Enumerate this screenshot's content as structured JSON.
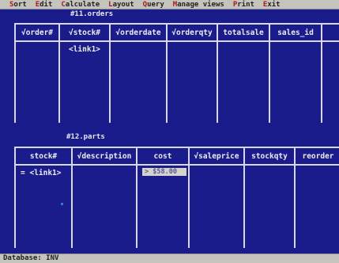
{
  "menubar": {
    "items": [
      {
        "hotkey": "S",
        "rest": "ort"
      },
      {
        "hotkey": "E",
        "rest": "dit"
      },
      {
        "hotkey": "C",
        "rest": "alculate"
      },
      {
        "hotkey": "L",
        "rest": "ayout"
      },
      {
        "hotkey": "Q",
        "rest": "uery"
      },
      {
        "hotkey": "M",
        "rest": "anage views"
      },
      {
        "hotkey": "P",
        "rest": "rint"
      },
      {
        "hotkey": "E",
        "rest": "xit"
      }
    ]
  },
  "tables": {
    "orders": {
      "title": "#11.orders",
      "columns": [
        "√order#",
        "√stock#",
        "√orderdate",
        "√orderqty",
        "totalsale",
        "sales_id"
      ],
      "cells": [
        "",
        "<link1>",
        "",
        "",
        "",
        ""
      ]
    },
    "parts": {
      "title": "#12.parts",
      "columns": [
        "stock#",
        "√description",
        "cost",
        "√saleprice",
        "stockqty",
        "reorder"
      ],
      "cells": [
        "= <link1>",
        "",
        "> $58.00",
        "",
        "",
        ""
      ]
    }
  },
  "statusbar": {
    "text": "Database: INV"
  }
}
